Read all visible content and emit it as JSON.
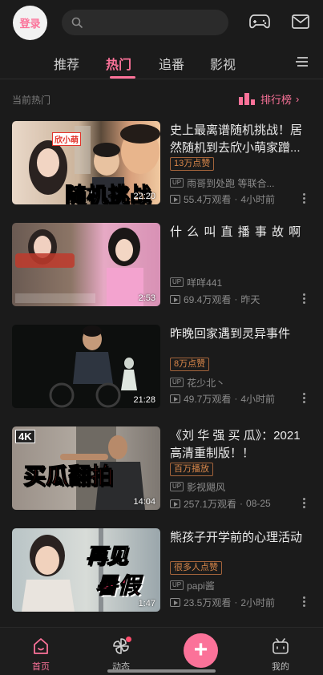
{
  "header": {
    "login_label": "登录",
    "icons": [
      "search-icon",
      "game-controller-icon",
      "mail-icon"
    ]
  },
  "tabs": [
    {
      "label": "推荐",
      "active": false
    },
    {
      "label": "热门",
      "active": true
    },
    {
      "label": "追番",
      "active": false
    },
    {
      "label": "影视",
      "active": false
    }
  ],
  "section": {
    "title": "当前热门",
    "rank_label": "排行榜"
  },
  "videos": [
    {
      "title": "史上最离谱随机挑战！居然随机到去欣小萌家蹭...",
      "duration": "22:20",
      "badge": "13万点赞",
      "author": "雨哥到处跑 等联合...",
      "views": "55.4万观看",
      "time": "4小时前"
    },
    {
      "title": "什 么 叫 直 播 事 故 啊",
      "duration": "2:53",
      "badge": "",
      "author": "咩咩441",
      "views": "69.4万观看",
      "time": "昨天"
    },
    {
      "title": "昨晚回家遇到灵异事件",
      "duration": "21:28",
      "badge": "8万点赞",
      "author": "花少北丶",
      "views": "49.7万观看",
      "time": "4小时前"
    },
    {
      "title": "《刘 华 强 买 瓜》：2021高清重制版！！",
      "duration": "14:04",
      "badge": "百万播放",
      "author": "影视飓风",
      "views": "257.1万观看",
      "time": "08-25"
    },
    {
      "title": "熊孩子开学前的心理活动",
      "duration": "1:47",
      "badge": "很多人点赞",
      "author": "papi酱",
      "views": "23.5万观看",
      "time": "2小时前"
    }
  ],
  "thumb_text": {
    "v1_overlay": "随机挑战",
    "v1_tag": "欣小萌",
    "v4_overlay": "买瓜翻拍",
    "v4_tag": "4K",
    "v5_line1": "再见",
    "v5_line2": "暑假"
  },
  "bottom_nav": [
    {
      "label": "首页",
      "active": true
    },
    {
      "label": "动态",
      "active": false
    },
    {
      "label": "我的",
      "active": false
    }
  ],
  "colors": {
    "accent": "#fb7299",
    "badge": "#d9874a",
    "background": "#1b1b1b"
  }
}
